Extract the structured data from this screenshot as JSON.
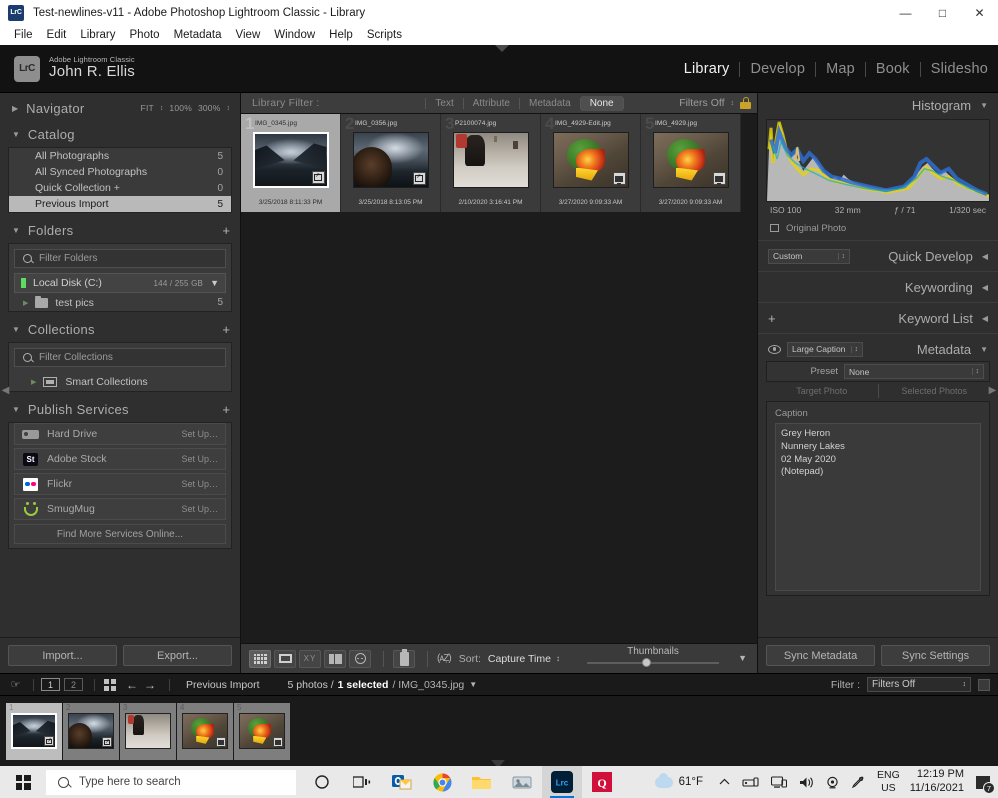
{
  "window": {
    "title": "Test-newlines-v11 - Adobe Photoshop Lightroom Classic - Library",
    "app_icon": "LrC",
    "minimize": "—",
    "maximize": "□",
    "close": "✕"
  },
  "menubar": [
    {
      "label": "File"
    },
    {
      "label": "Edit"
    },
    {
      "label": "Library"
    },
    {
      "label": "Photo"
    },
    {
      "label": "Metadata"
    },
    {
      "label": "View"
    },
    {
      "label": "Window"
    },
    {
      "label": "Help"
    },
    {
      "label": "Scripts"
    }
  ],
  "identity": {
    "logo": "LrC",
    "product": "Adobe Lightroom Classic",
    "user": "John R. Ellis"
  },
  "modules": [
    {
      "label": "Library",
      "active": true
    },
    {
      "label": "Develop",
      "active": false
    },
    {
      "label": "Map",
      "active": false
    },
    {
      "label": "Book",
      "active": false
    },
    {
      "label": "Slidesho",
      "active": false
    }
  ],
  "left_panel": {
    "navigator": {
      "title": "Navigator",
      "fit": "FIT",
      "zoom_100": "100%",
      "zoom_300": "300%"
    },
    "catalog": {
      "title": "Catalog",
      "items": [
        {
          "label": "All Photographs",
          "count": "5",
          "selected": false
        },
        {
          "label": "All Synced Photographs",
          "count": "0",
          "selected": false
        },
        {
          "label": "Quick Collection +",
          "count": "0",
          "selected": false
        },
        {
          "label": "Previous Import",
          "count": "5",
          "selected": true
        }
      ]
    },
    "folders": {
      "title": "Folders",
      "filter_placeholder": "Filter Folders",
      "volume": {
        "name": "Local Disk (C:)",
        "capacity": "144 / 255 GB"
      },
      "items": [
        {
          "label": "test pics",
          "count": "5"
        }
      ]
    },
    "collections": {
      "title": "Collections",
      "filter_placeholder": "Filter Collections",
      "items": [
        {
          "label": "Smart Collections"
        }
      ]
    },
    "publish_services": {
      "title": "Publish Services",
      "items": [
        {
          "label": "Hard Drive",
          "action": "Set Up…",
          "icon": "harddrive-icon"
        },
        {
          "label": "Adobe Stock",
          "action": "Set Up…",
          "icon": "adobe-stock-icon"
        },
        {
          "label": "Flickr",
          "action": "Set Up…",
          "icon": "flickr-icon"
        },
        {
          "label": "SmugMug",
          "action": "Set Up…",
          "icon": "smugmug-icon"
        }
      ],
      "find_more": "Find More Services Online..."
    },
    "buttons": {
      "import": "Import...",
      "export": "Export..."
    }
  },
  "library_filter": {
    "label": "Library Filter :",
    "tabs": [
      {
        "label": "Text",
        "active": false
      },
      {
        "label": "Attribute",
        "active": false
      },
      {
        "label": "Metadata",
        "active": false
      },
      {
        "label": "None",
        "active": true
      }
    ],
    "filters_state": "Filters Off",
    "lock_icon": "lock-icon"
  },
  "grid": {
    "cells": [
      {
        "index": "1",
        "name": "IMG_0345.jpg",
        "date": "3/25/2018 8:11:33 PM",
        "art": "lake",
        "badge": "crop",
        "selected": true
      },
      {
        "index": "2",
        "name": "IMG_0356.jpg",
        "date": "3/25/2018 8:13:05 PM",
        "art": "lake2",
        "badge": "crop",
        "selected": false
      },
      {
        "index": "3",
        "name": "P2100074.jpg",
        "date": "2/10/2020 3:16:41 PM",
        "art": "market",
        "badge": "none",
        "selected": false
      },
      {
        "index": "4",
        "name": "IMG_4929-Edit.jpg",
        "date": "3/27/2020 9:09:33 AM",
        "art": "duck",
        "badge": "monitor",
        "selected": false
      },
      {
        "index": "5",
        "name": "IMG_4929.jpg",
        "date": "3/27/2020 9:09:33 AM",
        "art": "duck",
        "badge": "monitor",
        "selected": false
      }
    ]
  },
  "grid_toolbar": {
    "view_buttons": [
      {
        "icon": "grid-view-icon",
        "active": true
      },
      {
        "icon": "loupe-view-icon",
        "active": false
      },
      {
        "icon": "compare-view-icon",
        "active": false
      },
      {
        "icon": "survey-view-icon",
        "active": false
      },
      {
        "icon": "people-view-icon",
        "active": false
      }
    ],
    "painter_icon": "spray-can-icon",
    "sort_icon": "sort-az-icon",
    "sort_label": "Sort:",
    "sort_value": "Capture Time",
    "thumbnails_label": "Thumbnails",
    "toolbar_menu_icon": "chevron-down-icon"
  },
  "right_panel": {
    "histogram": {
      "title": "Histogram",
      "iso": "ISO 100",
      "focal": "32 mm",
      "aperture": "ƒ / 71",
      "shutter": "1/320 sec",
      "original_photo": "Original Photo"
    },
    "quick_develop": {
      "title": "Quick Develop",
      "preset_value": "Custom"
    },
    "keywording": {
      "title": "Keywording"
    },
    "keyword_list": {
      "title": "Keyword List",
      "add_icon": "plus-icon"
    },
    "metadata": {
      "title": "Metadata",
      "view_value": "Large Caption",
      "eye_icon": "eye-icon",
      "preset_label": "Preset",
      "preset_value": "None",
      "target_photo": "Target Photo",
      "selected_photos": "Selected Photos",
      "caption_label": "Caption",
      "caption_value": "Grey Heron\nNunnery Lakes\n02 May 2020\n(Notepad)"
    },
    "buttons": {
      "sync_metadata": "Sync Metadata",
      "sync_settings": "Sync Settings"
    }
  },
  "filmstrip": {
    "nav_icon": "hand-icon",
    "page1": "1",
    "page2": "2",
    "grid_icon": "grid-icon",
    "back_icon": "arrow-left-icon",
    "forward_icon": "arrow-right-icon",
    "source": "Previous Import",
    "count_photos": "5 photos /",
    "count_selected": "1 selected",
    "count_file": "/ IMG_0345.jpg",
    "dropdown_icon": "chevron-down-icon",
    "filter_label": "Filter :",
    "filter_value": "Filters Off",
    "cells": [
      {
        "index": "1",
        "art": "lake",
        "badge": "crop",
        "selected": true
      },
      {
        "index": "2",
        "art": "lake2",
        "badge": "crop",
        "selected": false
      },
      {
        "index": "3",
        "art": "market",
        "badge": "none",
        "selected": false
      },
      {
        "index": "4",
        "art": "duck",
        "badge": "monitor",
        "selected": false
      },
      {
        "index": "5",
        "art": "duck",
        "badge": "monitor",
        "selected": false
      }
    ]
  },
  "taskbar": {
    "search_placeholder": "Type here to search",
    "apps": [
      {
        "name": "cortana-icon",
        "active": false
      },
      {
        "name": "task-view-icon",
        "active": false
      },
      {
        "name": "outlook-icon",
        "active": false
      },
      {
        "name": "chrome-icon",
        "active": false
      },
      {
        "name": "file-explorer-icon",
        "active": false
      },
      {
        "name": "photos-icon",
        "active": false
      },
      {
        "name": "lightroom-icon",
        "active": true
      },
      {
        "name": "quicken-icon",
        "active": false
      }
    ],
    "weather": "61°F",
    "lang_primary": "ENG",
    "lang_secondary": "US",
    "time": "12:19 PM",
    "date": "11/16/2021",
    "notification_count": "7"
  },
  "colors": {
    "accent": "#0078d7",
    "panel_bg": "#2f2f2f",
    "canvas_bg": "#1c1c1c",
    "flickr_pink": "#ff0084",
    "flickr_blue": "#0063dc",
    "smugmug_green": "#9ccb3b"
  }
}
